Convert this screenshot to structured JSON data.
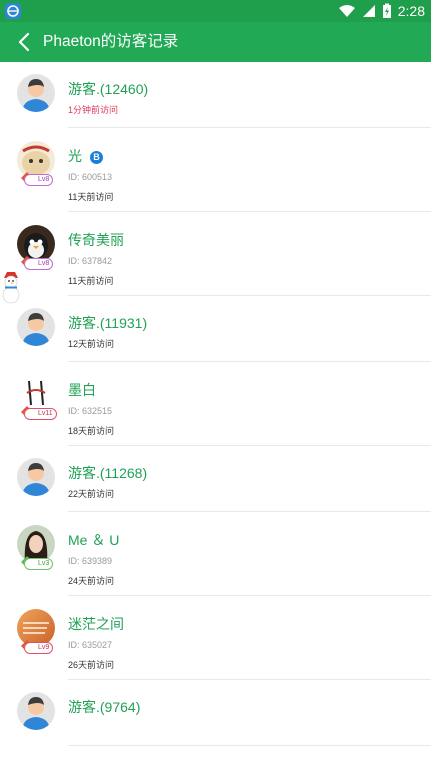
{
  "status_bar": {
    "time": "2:28"
  },
  "header": {
    "title": "Phaeton的访客记录"
  },
  "visitors": [
    {
      "name": "游客.(12460)",
      "id": "",
      "visit": "1分钟前访问",
      "level": "",
      "recent": true
    },
    {
      "name": "光",
      "id": "ID: 600513",
      "visit": "11天前访问",
      "level": "Lv8"
    },
    {
      "name": "传奇美丽",
      "id": "ID: 637842",
      "visit": "11天前访问",
      "level": "Lv8"
    },
    {
      "name": "游客.(11931)",
      "id": "",
      "visit": "12天前访问",
      "level": ""
    },
    {
      "name": "墨白",
      "id": "ID: 632515",
      "visit": "18天前访问",
      "level": "Lv11"
    },
    {
      "name": "游客.(11268)",
      "id": "",
      "visit": "22天前访问",
      "level": ""
    },
    {
      "name": "Me ＆ U",
      "id": "ID: 639389",
      "visit": "24天前访问",
      "level": "Lv3"
    },
    {
      "name": "迷茫之间",
      "id": "ID: 635027",
      "visit": "26天前访问",
      "level": "Lv9"
    },
    {
      "name": "游客.(9764)",
      "id": "",
      "visit": "",
      "level": ""
    }
  ]
}
